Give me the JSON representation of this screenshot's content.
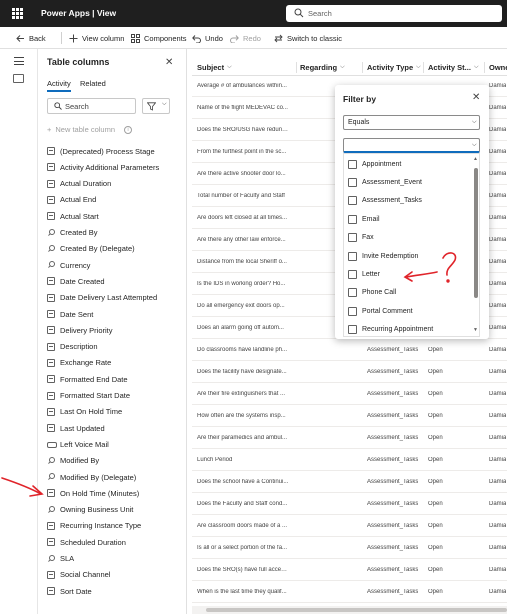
{
  "app": {
    "title": "Power Apps | View",
    "search_placeholder": "Search"
  },
  "commandbar": {
    "back": "Back",
    "view_column": "View column",
    "components": "Components",
    "undo": "Undo",
    "redo": "Redo",
    "switch_classic": "Switch to classic"
  },
  "panel": {
    "title": "Table columns",
    "tabs": [
      "Activity",
      "Related"
    ],
    "search_placeholder": "Search",
    "new_column": "New table column",
    "columns": [
      {
        "label": "(Deprecated) Process Stage",
        "icon": "field-icon"
      },
      {
        "label": "Activity Additional Parameters",
        "icon": "field-icon"
      },
      {
        "label": "Actual Duration",
        "icon": "field-icon"
      },
      {
        "label": "Actual End",
        "icon": "field-icon"
      },
      {
        "label": "Actual Start",
        "icon": "field-icon"
      },
      {
        "label": "Created By",
        "icon": "lookup-icon"
      },
      {
        "label": "Created By (Delegate)",
        "icon": "lookup-icon"
      },
      {
        "label": "Currency",
        "icon": "lookup-icon"
      },
      {
        "label": "Date Created",
        "icon": "field-icon"
      },
      {
        "label": "Date Delivery Last Attempted",
        "icon": "field-icon"
      },
      {
        "label": "Date Sent",
        "icon": "field-icon"
      },
      {
        "label": "Delivery Priority",
        "icon": "field-icon"
      },
      {
        "label": "Description",
        "icon": "field-icon"
      },
      {
        "label": "Exchange Rate",
        "icon": "field-icon"
      },
      {
        "label": "Formatted End Date",
        "icon": "field-icon"
      },
      {
        "label": "Formatted Start Date",
        "icon": "field-icon"
      },
      {
        "label": "Last On Hold Time",
        "icon": "field-icon"
      },
      {
        "label": "Last Updated",
        "icon": "field-icon"
      },
      {
        "label": "Left Voice Mail",
        "icon": "voicemail-icon"
      },
      {
        "label": "Modified By",
        "icon": "lookup-icon"
      },
      {
        "label": "Modified By (Delegate)",
        "icon": "lookup-icon"
      },
      {
        "label": "On Hold Time (Minutes)",
        "icon": "field-icon"
      },
      {
        "label": "Owning Business Unit",
        "icon": "lookup-icon"
      },
      {
        "label": "Recurring Instance Type",
        "icon": "field-icon"
      },
      {
        "label": "Scheduled Duration",
        "icon": "field-icon"
      },
      {
        "label": "SLA",
        "icon": "lookup-icon"
      },
      {
        "label": "Social Channel",
        "icon": "field-icon"
      },
      {
        "label": "Sort Date",
        "icon": "field-icon"
      }
    ]
  },
  "grid": {
    "headers": [
      "Subject",
      "Regarding",
      "Activity Type",
      "Activity St...",
      "Owne"
    ],
    "rows": [
      {
        "subject": "Average # of ambulances within...",
        "type": "",
        "status": "",
        "owner": "Damia"
      },
      {
        "subject": "Name of the flight MEDEVAC co...",
        "type": "",
        "status": "",
        "owner": "Damia"
      },
      {
        "subject": "Does the SRO/USG have redund...",
        "type": "",
        "status": "",
        "owner": "Damia"
      },
      {
        "subject": "From the furthest point in the sc...",
        "type": "",
        "status": "",
        "owner": "Damia"
      },
      {
        "subject": "Are there active shooter door lo...",
        "type": "",
        "status": "",
        "owner": "Damia"
      },
      {
        "subject": "Total number of Faculty and Staff",
        "type": "",
        "status": "",
        "owner": "Damia"
      },
      {
        "subject": "Are doors left closed at all times...",
        "type": "",
        "status": "",
        "owner": "Damia"
      },
      {
        "subject": "Are there any other law enforce...",
        "type": "",
        "status": "",
        "owner": "Damia"
      },
      {
        "subject": "Distance from the local Sheriff o...",
        "type": "",
        "status": "",
        "owner": "Damia"
      },
      {
        "subject": "Is the IDS in working order? Ho...",
        "type": "",
        "status": "",
        "owner": "Damia"
      },
      {
        "subject": "Do all emergency exit doors op...",
        "type": "",
        "status": "",
        "owner": "Damia"
      },
      {
        "subject": "Does an alarm going off autom...",
        "type": "",
        "status": "",
        "owner": "Damia"
      },
      {
        "subject": "Do classrooms have landline ph...",
        "type": "Assessment_Tasks",
        "status": "Open",
        "owner": "Damia"
      },
      {
        "subject": "Does the facility have designate...",
        "type": "Assessment_Tasks",
        "status": "Open",
        "owner": "Damia"
      },
      {
        "subject": "Are their fire extinguishers that ...",
        "type": "Assessment_Tasks",
        "status": "Open",
        "owner": "Damia"
      },
      {
        "subject": "How often are the systems insp...",
        "type": "Assessment_Tasks",
        "status": "Open",
        "owner": "Damia"
      },
      {
        "subject": "Are their paramedics and ambul...",
        "type": "Assessment_Tasks",
        "status": "Open",
        "owner": "Damia"
      },
      {
        "subject": "Lunch Period",
        "type": "Assessment_Tasks",
        "status": "Open",
        "owner": "Damia"
      },
      {
        "subject": "Does the school have a Continui...",
        "type": "Assessment_Tasks",
        "status": "Open",
        "owner": "Damia"
      },
      {
        "subject": "Does the Faculty and Staff cond...",
        "type": "Assessment_Tasks",
        "status": "Open",
        "owner": "Damia"
      },
      {
        "subject": "Are classroom doors made of a ...",
        "type": "Assessment_Tasks",
        "status": "Open",
        "owner": "Damia"
      },
      {
        "subject": "Is all or a select portion of the fa...",
        "type": "Assessment_Tasks",
        "status": "Open",
        "owner": "Damia"
      },
      {
        "subject": "Does the SRO(s) have full access...",
        "type": "Assessment_Tasks",
        "status": "Open",
        "owner": "Damia"
      },
      {
        "subject": "When is the last time they qualif...",
        "type": "Assessment_Tasks",
        "status": "Open",
        "owner": "Damia"
      }
    ]
  },
  "filter": {
    "title": "Filter by",
    "operator": "Equals",
    "value": "",
    "options": [
      "Appointment",
      "Assessment_Event",
      "Assessment_Tasks",
      "Email",
      "Fax",
      "Invite Redemption",
      "Letter",
      "Phone Call",
      "Portal Comment",
      "Recurring Appointment"
    ]
  },
  "colors": {
    "topbar": "#1f1f1f",
    "accent": "#0f6cbd",
    "annotation": "#e0242a"
  }
}
